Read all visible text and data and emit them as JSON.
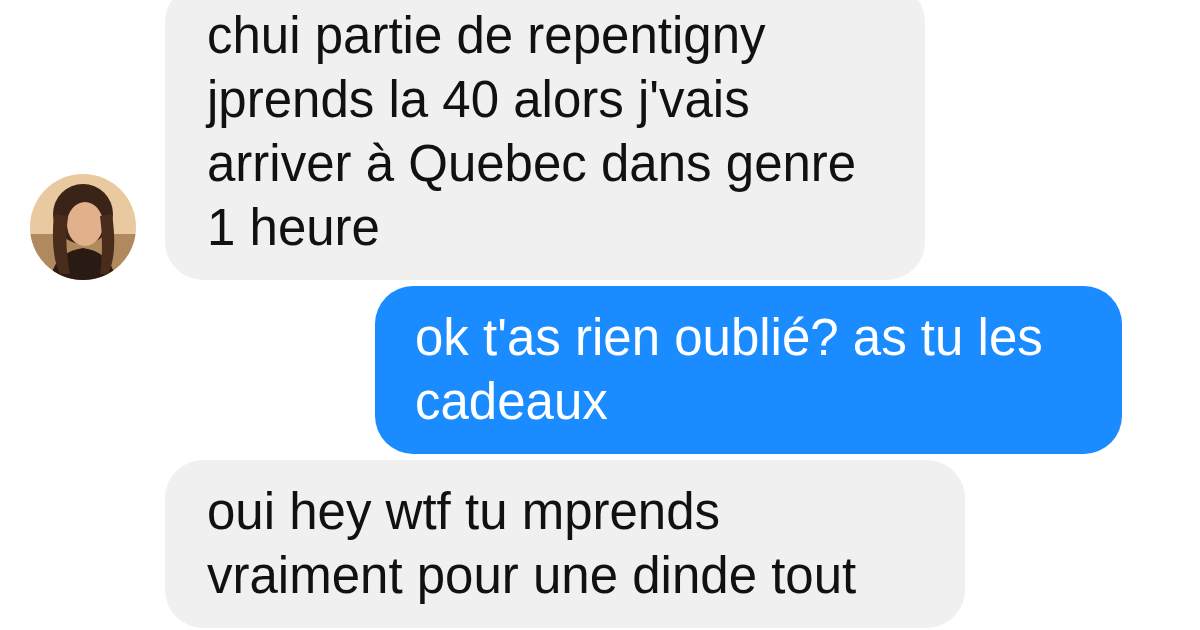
{
  "messages": [
    {
      "kind": "incoming",
      "show_avatar": true,
      "text": "chui partie de repentigny jprends la 40 alors j'vais arriver à Quebec dans genre 1 heure"
    },
    {
      "kind": "outgoing",
      "text": "ok t'as rien oublié? as tu les cadeaux"
    },
    {
      "kind": "incoming",
      "show_avatar": false,
      "text": "oui hey wtf tu mprends vraiment pour une dinde tout"
    }
  ]
}
